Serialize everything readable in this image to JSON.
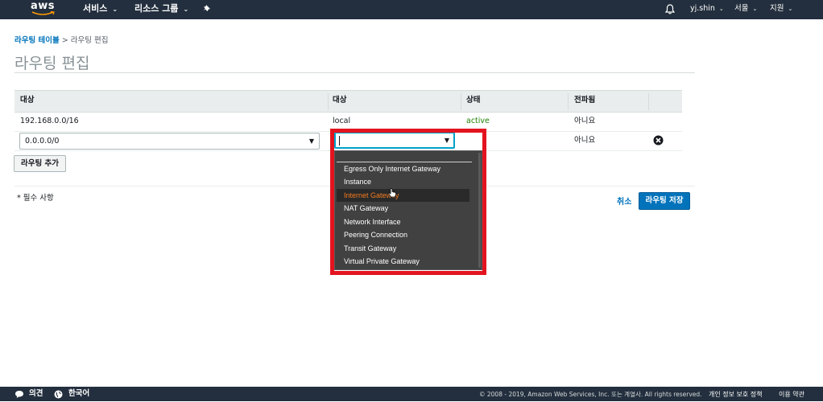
{
  "nav": {
    "logo": "aws",
    "menus": [
      "서비스",
      "리소스 그룹"
    ],
    "caret": "⌄",
    "user": "yj.shin",
    "region": "서울",
    "support": "지원"
  },
  "breadcrumb": {
    "parent": "라우팅 테이블",
    "separator": ">",
    "current": "라우팅 편집"
  },
  "page": {
    "title": "라우팅 편집"
  },
  "table": {
    "headers": [
      "대상",
      "대상",
      "상태",
      "전파됨"
    ],
    "rows": [
      {
        "destination": "192.168.0.0/16",
        "target": "local",
        "status": "active",
        "propagated": "아니요"
      },
      {
        "destination": "0.0.0.0/0",
        "target": "",
        "status": "",
        "propagated": "아니요"
      }
    ]
  },
  "buttons": {
    "add_route": "라우팅 추가",
    "cancel": "취소",
    "save": "라우팅 저장"
  },
  "required_note": "* 필수 사항",
  "dropdown": {
    "options": [
      "Egress Only Internet Gateway",
      "Instance",
      "Internet Gateway",
      "NAT Gateway",
      "Network Interface",
      "Peering Connection",
      "Transit Gateway",
      "Virtual Private Gateway"
    ],
    "hovered_index": 2
  },
  "footer": {
    "feedback": "의견",
    "language": "한국어",
    "copyright": "© 2008 - 2019, Amazon Web Services, Inc. 또는 계열사. All rights reserved.",
    "privacy": "개인 정보 보호 정책",
    "terms": "이용 약관"
  },
  "colors": {
    "nav_bg": "#232f3e",
    "link": "#0073bb",
    "status_active": "#1d8102",
    "highlight": "#e3141f",
    "hover_text": "#f47b20"
  }
}
